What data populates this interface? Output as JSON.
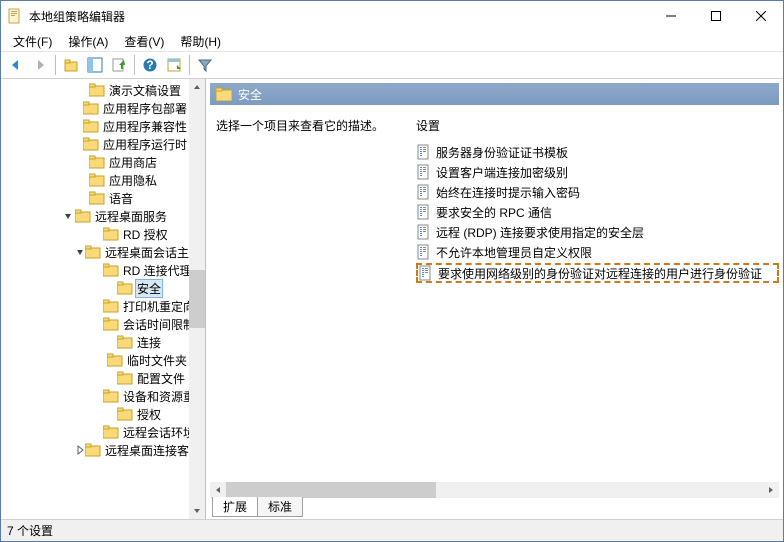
{
  "window": {
    "title": "本地组策略编辑器"
  },
  "menu": {
    "file": "文件(F)",
    "action": "操作(A)",
    "view": "查看(V)",
    "help": "帮助(H)"
  },
  "tree": {
    "items": [
      {
        "indent": 74,
        "tw": "",
        "label": "演示文稿设置"
      },
      {
        "indent": 74,
        "tw": "",
        "label": "应用程序包部署"
      },
      {
        "indent": 74,
        "tw": "",
        "label": "应用程序兼容性"
      },
      {
        "indent": 74,
        "tw": "",
        "label": "应用程序运行时"
      },
      {
        "indent": 74,
        "tw": "",
        "label": "应用商店"
      },
      {
        "indent": 74,
        "tw": "",
        "label": "应用隐私"
      },
      {
        "indent": 74,
        "tw": "",
        "label": "语音"
      },
      {
        "indent": 60,
        "tw": "v",
        "label": "远程桌面服务"
      },
      {
        "indent": 88,
        "tw": "",
        "label": "RD 授权"
      },
      {
        "indent": 74,
        "tw": "v",
        "label": "远程桌面会话主机"
      },
      {
        "indent": 102,
        "tw": "",
        "label": "RD 连接代理"
      },
      {
        "indent": 102,
        "tw": "",
        "label": "安全",
        "selected": true
      },
      {
        "indent": 102,
        "tw": "",
        "label": "打印机重定向"
      },
      {
        "indent": 102,
        "tw": "",
        "label": "会话时间限制"
      },
      {
        "indent": 102,
        "tw": "",
        "label": "连接"
      },
      {
        "indent": 102,
        "tw": "",
        "label": "临时文件夹"
      },
      {
        "indent": 102,
        "tw": "",
        "label": "配置文件"
      },
      {
        "indent": 102,
        "tw": "",
        "label": "设备和资源重定向"
      },
      {
        "indent": 102,
        "tw": "",
        "label": "授权"
      },
      {
        "indent": 102,
        "tw": "",
        "label": "远程会话环境"
      },
      {
        "indent": 74,
        "tw": ">",
        "label": "远程桌面连接客户端"
      }
    ]
  },
  "header": {
    "title": "安全"
  },
  "desc": "选择一个项目来查看它的描述。",
  "settings": {
    "header": "设置",
    "items": [
      "服务器身份验证证书模板",
      "设置客户端连接加密级别",
      "始终在连接时提示输入密码",
      "要求安全的 RPC 通信",
      "远程 (RDP) 连接要求使用指定的安全层",
      "不允许本地管理员自定义权限",
      "要求使用网络级别的身份验证对远程连接的用户进行身份验证"
    ],
    "highlight_index": 6
  },
  "tabs": {
    "extended": "扩展",
    "standard": "标准"
  },
  "status": "7 个设置"
}
